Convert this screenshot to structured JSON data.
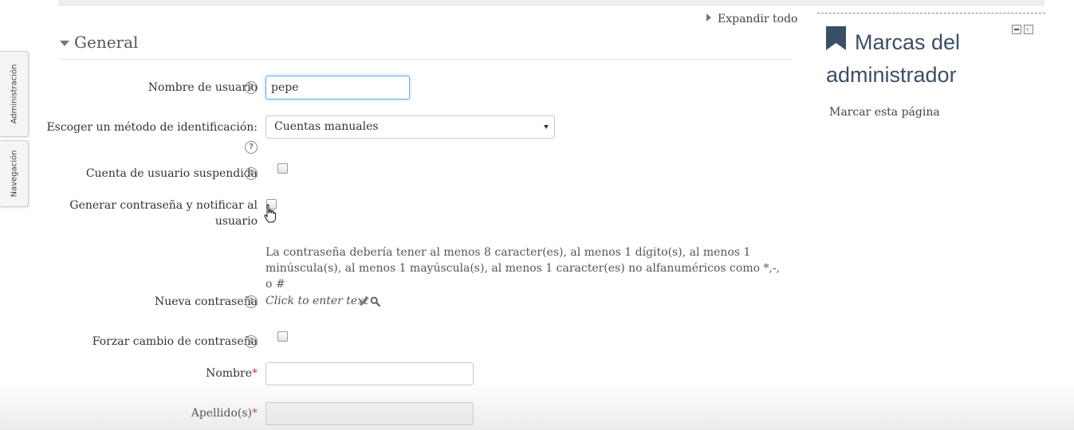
{
  "dock": {
    "administration_label": "Administración",
    "navigation_label": "Navegación"
  },
  "form": {
    "expand_all": "Expandir todo",
    "section_title": "General",
    "username": {
      "label": "Nombre de usuario",
      "value": "pepe"
    },
    "auth_method": {
      "label": "Escoger un método de identificación:",
      "selected": "Cuentas manuales"
    },
    "suspended": {
      "label": "Cuenta de usuario suspendida"
    },
    "generate_password": {
      "label_line1": "Generar contraseña y notificar al",
      "label_line2": "usuario"
    },
    "password_policy": "La contraseña debería tener al menos 8 caracter(es), al menos 1 dígito(s), al menos 1 minúscula(s), al menos 1 mayúscula(s), al menos 1 caracter(es) no alfanuméricos como *,-, o #",
    "new_password": {
      "label": "Nueva contraseña",
      "placeholder_text": "Click to enter text"
    },
    "force_change": {
      "label": "Forzar cambio de contraseña"
    },
    "first_name": {
      "label": "Nombre",
      "required_mark": "*",
      "value": ""
    },
    "last_name": {
      "label": "Apellido(s)",
      "required_mark": "*",
      "value": ""
    }
  },
  "block": {
    "title": "Marcas del administrador",
    "link": "Marcar esta página"
  },
  "icons": {
    "help": "?",
    "bookmark": "bookmark-icon",
    "pencil": "pencil-icon",
    "search": "magnifier-icon"
  },
  "colors": {
    "focus_border": "#66afe9",
    "block_title": "#3a4f66",
    "required": "#c0392b"
  }
}
